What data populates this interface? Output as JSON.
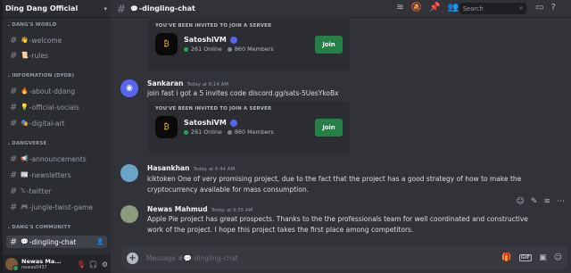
{
  "server": {
    "name": "Ding Dang Official",
    "badge": "®"
  },
  "categories": [
    {
      "label": "DANG'S WORLD"
    },
    {
      "label": "INFORMATION (DYOR)"
    },
    {
      "label": "DANGVERSE"
    },
    {
      "label": "DANG'S COMMUNITY"
    }
  ],
  "channels": [
    {
      "emoji": "👋",
      "label": "-welcome"
    },
    {
      "emoji": "📜",
      "label": "-rules"
    },
    {
      "emoji": "🔥",
      "label": "-about-ddang"
    },
    {
      "emoji": "💡",
      "label": "-official-socials"
    },
    {
      "emoji": "🎭",
      "label": "-digital-art"
    },
    {
      "emoji": "📢",
      "label": "-announcements"
    },
    {
      "emoji": "📰",
      "label": "-newsletters"
    },
    {
      "emoji": "𝕏",
      "label": "-twitter"
    },
    {
      "emoji": "🎮",
      "label": "-jungle-twist-game"
    },
    {
      "emoji": "💬",
      "label": "-dingling-chat"
    }
  ],
  "user": {
    "name": "Newas Ma...",
    "tag": "newas0437"
  },
  "topbar": {
    "channel_emoji": "💬",
    "channel": "-dingling-chat",
    "search_placeholder": "Search"
  },
  "invite": {
    "label": "YOU'VE BEEN INVITED TO JOIN A SERVER",
    "server": "SatoshiVM",
    "online": "261 Online",
    "members": "860 Members",
    "join": "Join"
  },
  "messages": [
    {
      "author": "Sankaran",
      "time": "Today at 6:14 AM",
      "text": "join fast i got a 5 invites code discord.gg/sats-5UesYkoBx"
    },
    {
      "author": "Hasankhan",
      "time": "Today at 6:44 AM",
      "text": "kiktoken One of very promising project, due to the fact that the project has a good strategy of how to make the cryptocurrency available for mass consumption."
    },
    {
      "author": "Newas Mahmud",
      "time": "Today at 9:55 AM",
      "text": "Apple Pie project has great prospects. Thanks to the the professionals team for well coordinated and constructive work of the project. I hope this project takes the first place among competitors."
    }
  ],
  "composer": {
    "placeholder": "Message #💬-dingling-chat"
  }
}
